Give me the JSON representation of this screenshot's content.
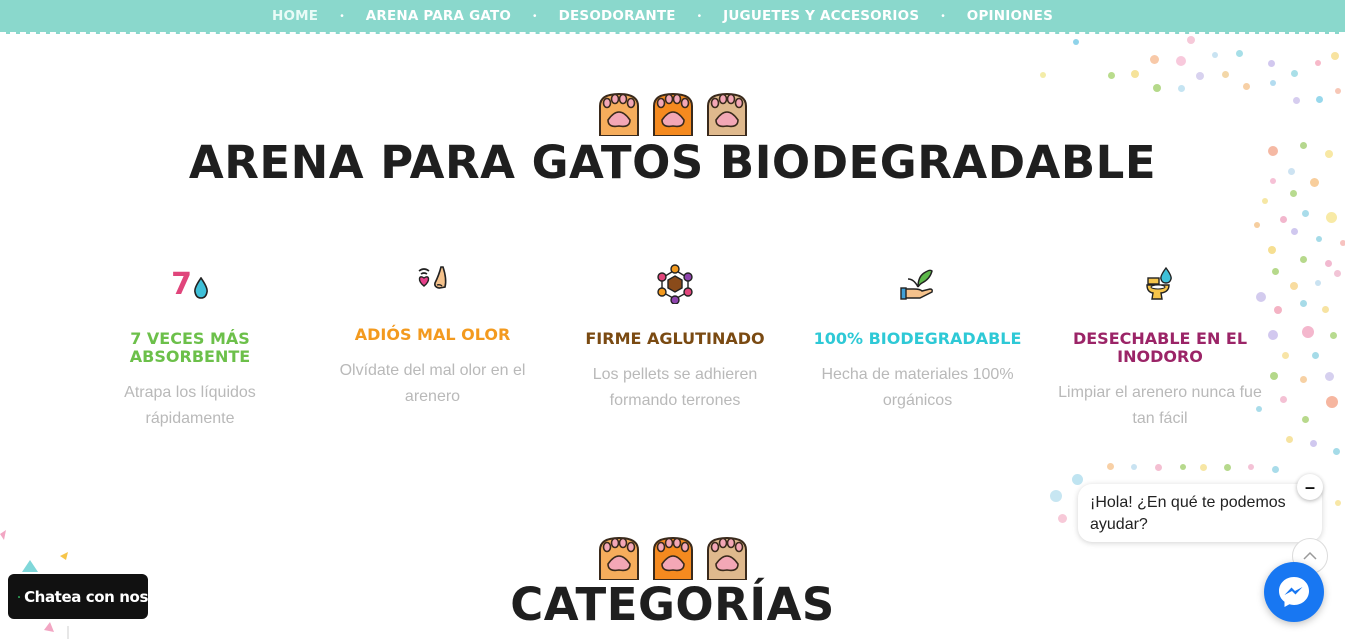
{
  "nav": {
    "items": [
      "HOME",
      "ARENA PARA GATO",
      "DESODORANTE",
      "JUGUETES Y ACCESORIOS",
      "OPINIONES"
    ],
    "separator": "•"
  },
  "hero": {
    "title": "ARENA PARA GATOS BIODEGRADABLE"
  },
  "features": [
    {
      "icon": "absorb-drop-icon",
      "icon_text": "7",
      "title": "7 VECES MÁS ABSORBENTE",
      "text": "Atrapa los líquidos rápidamente",
      "color": "#6cc04a"
    },
    {
      "icon": "nose-smell-icon",
      "title": "ADIÓS MAL OLOR",
      "text": "Olvídate del mal olor en el arenero",
      "color": "#f39a1e"
    },
    {
      "icon": "clumping-molecule-icon",
      "title": "FIRME AGLUTINADO",
      "text": "Los pellets se adhieren formando terrones",
      "color": "#7a4a12"
    },
    {
      "icon": "plant-hand-icon",
      "title": "100% BIODEGRADABLE",
      "text": "Hecha de materiales 100% orgánicos",
      "color": "#2ec9d6"
    },
    {
      "icon": "toilet-drop-icon",
      "title": "DESECHABLE EN EL INODORO",
      "text": "Limpiar el arenero nunca fue tan fácil",
      "color": "#9b2467"
    }
  ],
  "categories": {
    "title": "CATEGORÍAS"
  },
  "chat": {
    "greeting": "¡Hola! ¿En qué te podemos ayudar?",
    "close_symbol": "–"
  },
  "whatsapp": {
    "label": "Chatea con nos"
  },
  "colors": {
    "nav_bg": "#8ad8cc",
    "messenger": "#1877f2"
  }
}
